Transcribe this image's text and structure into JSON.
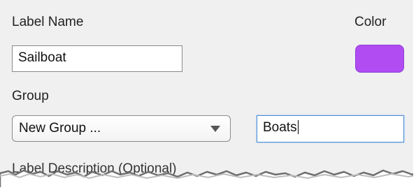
{
  "form": {
    "label_name_caption": "Label Name",
    "label_name_value": "Sailboat",
    "color_caption": "Color",
    "color_value": "#b04cf2",
    "group_caption": "Group",
    "group_select_value": "New Group ...",
    "group_name_value": "Boats",
    "description_caption": "Label Description (Optional)"
  },
  "icons": {
    "dropdown": "chevron-down-icon"
  }
}
